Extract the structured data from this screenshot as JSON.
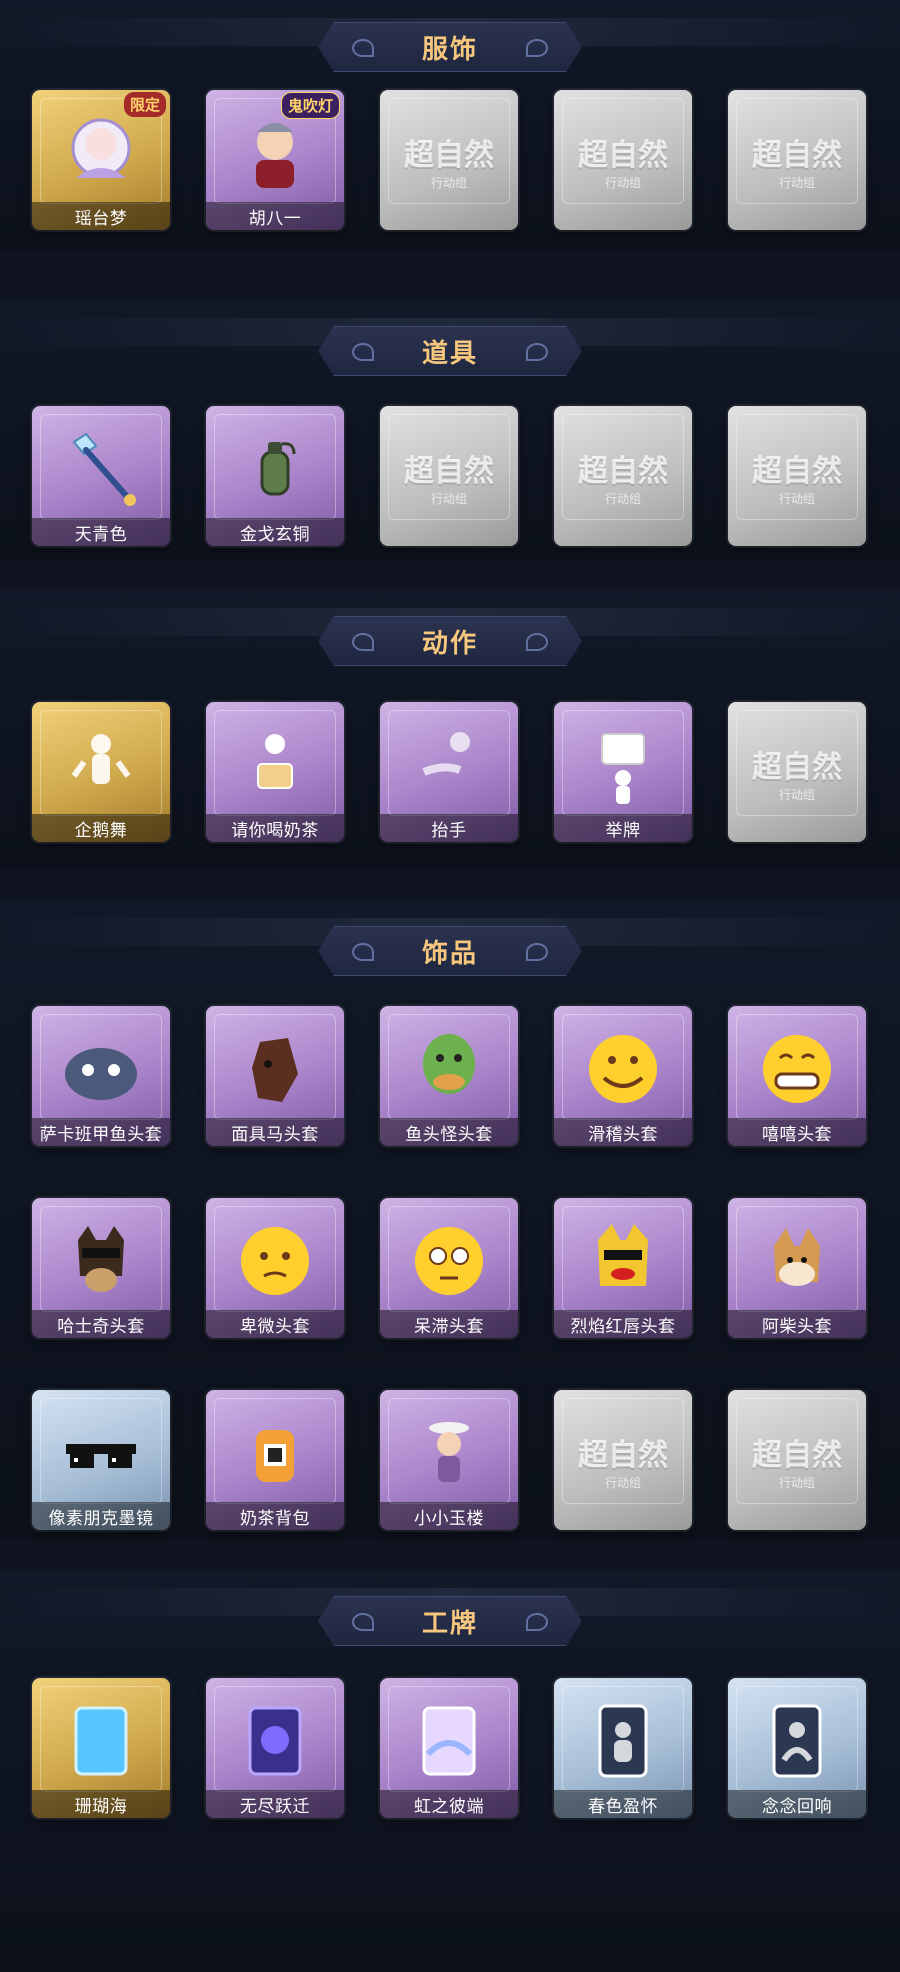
{
  "sections": [
    {
      "title": "服饰",
      "items": [
        {
          "label": "瑶台梦",
          "rarity": "gold",
          "badge": "限定",
          "icon": "character-costume-icon"
        },
        {
          "label": "胡八一",
          "rarity": "purple",
          "badge": "鬼吹灯",
          "icon": "character-costume-icon"
        },
        {
          "label": "",
          "rarity": "empty",
          "placeholder": "超自然",
          "placeholder_sub": "行动组"
        },
        {
          "label": "",
          "rarity": "empty",
          "placeholder": "超自然",
          "placeholder_sub": "行动组"
        },
        {
          "label": "",
          "rarity": "empty",
          "placeholder": "超自然",
          "placeholder_sub": "行动组"
        }
      ]
    },
    {
      "title": "道具",
      "items": [
        {
          "label": "天青色",
          "rarity": "purple",
          "icon": "shovel-icon"
        },
        {
          "label": "金戈玄铜",
          "rarity": "purple",
          "icon": "grenade-icon"
        },
        {
          "label": "",
          "rarity": "empty",
          "placeholder": "超自然",
          "placeholder_sub": "行动组"
        },
        {
          "label": "",
          "rarity": "empty",
          "placeholder": "超自然",
          "placeholder_sub": "行动组"
        },
        {
          "label": "",
          "rarity": "empty",
          "placeholder": "超自然",
          "placeholder_sub": "行动组"
        }
      ]
    },
    {
      "title": "动作",
      "items": [
        {
          "label": "企鹅舞",
          "rarity": "gold",
          "icon": "dance-pose-icon"
        },
        {
          "label": "请你喝奶茶",
          "rarity": "purple",
          "icon": "milk-tea-pose-icon"
        },
        {
          "label": "抬手",
          "rarity": "purple",
          "icon": "raise-hand-pose-icon"
        },
        {
          "label": "举牌",
          "rarity": "purple",
          "icon": "hold-sign-pose-icon"
        },
        {
          "label": "",
          "rarity": "empty",
          "placeholder": "超自然",
          "placeholder_sub": "行动组"
        }
      ]
    },
    {
      "title": "饰品",
      "items": [
        {
          "label": "萨卡班甲鱼头套",
          "rarity": "purple",
          "icon": "fish-head-mask-icon"
        },
        {
          "label": "面具马头套",
          "rarity": "purple",
          "icon": "horse-head-mask-icon"
        },
        {
          "label": "鱼头怪头套",
          "rarity": "purple",
          "icon": "fish-monster-mask-icon"
        },
        {
          "label": "滑稽头套",
          "rarity": "purple",
          "icon": "funny-face-mask-icon"
        },
        {
          "label": "嘻嘻头套",
          "rarity": "purple",
          "icon": "grin-face-mask-icon"
        },
        {
          "label": "哈士奇头套",
          "rarity": "purple",
          "icon": "husky-mask-icon"
        },
        {
          "label": "卑微头套",
          "rarity": "purple",
          "icon": "humble-face-mask-icon"
        },
        {
          "label": "呆滞头套",
          "rarity": "purple",
          "icon": "dazed-face-mask-icon"
        },
        {
          "label": "烈焰红唇头套",
          "rarity": "purple",
          "icon": "red-lips-mask-icon"
        },
        {
          "label": "阿柴头套",
          "rarity": "purple",
          "icon": "shiba-mask-icon"
        },
        {
          "label": "像素朋克墨镜",
          "rarity": "blue",
          "icon": "pixel-sunglasses-icon"
        },
        {
          "label": "奶茶背包",
          "rarity": "purple",
          "icon": "milk-tea-backpack-icon"
        },
        {
          "label": "小小玉楼",
          "rarity": "purple",
          "icon": "mini-figure-icon"
        },
        {
          "label": "",
          "rarity": "empty",
          "placeholder": "超自然",
          "placeholder_sub": "行动组"
        },
        {
          "label": "",
          "rarity": "empty",
          "placeholder": "超自然",
          "placeholder_sub": "行动组"
        }
      ]
    },
    {
      "title": "工牌",
      "items": [
        {
          "label": "珊瑚海",
          "rarity": "gold",
          "icon": "badge-card-icon"
        },
        {
          "label": "无尽跃迁",
          "rarity": "purple",
          "icon": "badge-card-icon"
        },
        {
          "label": "虹之彼端",
          "rarity": "purple",
          "icon": "badge-card-icon"
        },
        {
          "label": "春色盈怀",
          "rarity": "blue",
          "icon": "badge-card-icon"
        },
        {
          "label": "念念回响",
          "rarity": "blue",
          "icon": "badge-card-icon"
        }
      ]
    }
  ]
}
